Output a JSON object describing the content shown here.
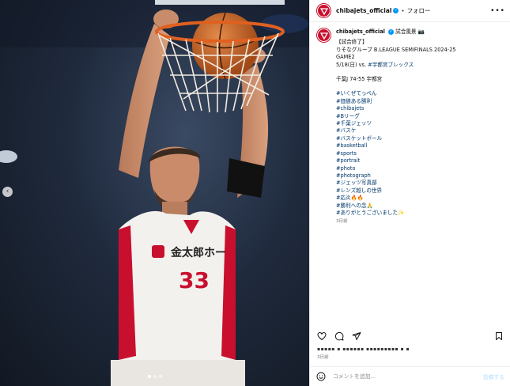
{
  "post": {
    "username": "chibajets_official",
    "follow_label": "フォロー",
    "separator": "•",
    "more_label": "•••"
  },
  "caption": {
    "username": "chibajets_official",
    "header_tag": "試合風景",
    "lines": [
      "【試合終了】",
      "りそなグループ B.LEAGUE SEMIFINALS 2024-25",
      "GAME2"
    ],
    "date_line": "5/18(日) vs. ",
    "opponent_tag": "#宇都宮ブレックス",
    "score": "千葉J 74-55 宇都宮",
    "hashtags": [
      "#いくぜてっぺん",
      "#価値ある勝利",
      "#chibajets",
      "#Bリーグ",
      "#千葉ジェッツ",
      "#バスケ",
      "#バスケットボール",
      "#basketball",
      "#sports",
      "#portrait",
      "#photo",
      "#photograph",
      "#ジェッツ写真部",
      "#レンズ越しの世界",
      "#応炎🔥🔥",
      "#勝利への念🙏",
      "#ありがとうございました✨"
    ],
    "time": "3日前"
  },
  "engagement": {
    "likes_text": "▪▪▪▪▪ ▪ ▪▪▪▪▪▪ ▪▪▪▪▪▪▪▪▪ ▪ ▪",
    "time": "3日前"
  },
  "comment": {
    "placeholder": "コメントを追加...",
    "post_label": "投稿する"
  },
  "photo": {
    "jersey_number": "33",
    "jersey_sponsor": "金太郎ホー"
  },
  "colors": {
    "brand": "#c8102e",
    "link": "#00376b",
    "verified": "#0095f6"
  }
}
